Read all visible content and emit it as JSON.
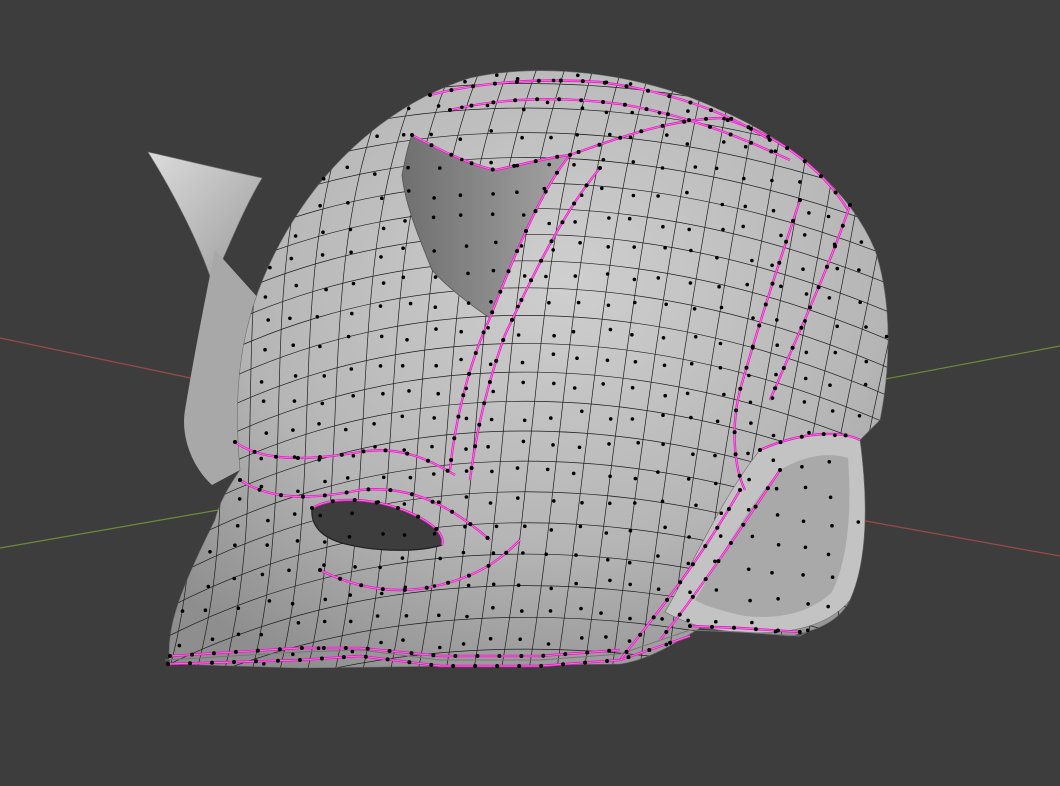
{
  "viewport": {
    "background_color": "#3d3d3d",
    "shading": "solid",
    "mode": "edit-mode",
    "selection_mode": "vertex"
  },
  "axes": {
    "x_axis_color": "#9a4a4a",
    "y_axis_color": "#6f8a3a"
  },
  "mesh": {
    "object": "helmet-mask",
    "surface_color": "#b9b9b9",
    "surface_shadow_color": "#8f8f8f",
    "wire_color": "#1e1e1e",
    "vertex_color": "#000000",
    "seam_color": "#e020c0",
    "seam_highlight_color": "#ff7ae6",
    "features": [
      "horn",
      "eye-hole",
      "mouth-hole",
      "jaw-guard"
    ]
  }
}
